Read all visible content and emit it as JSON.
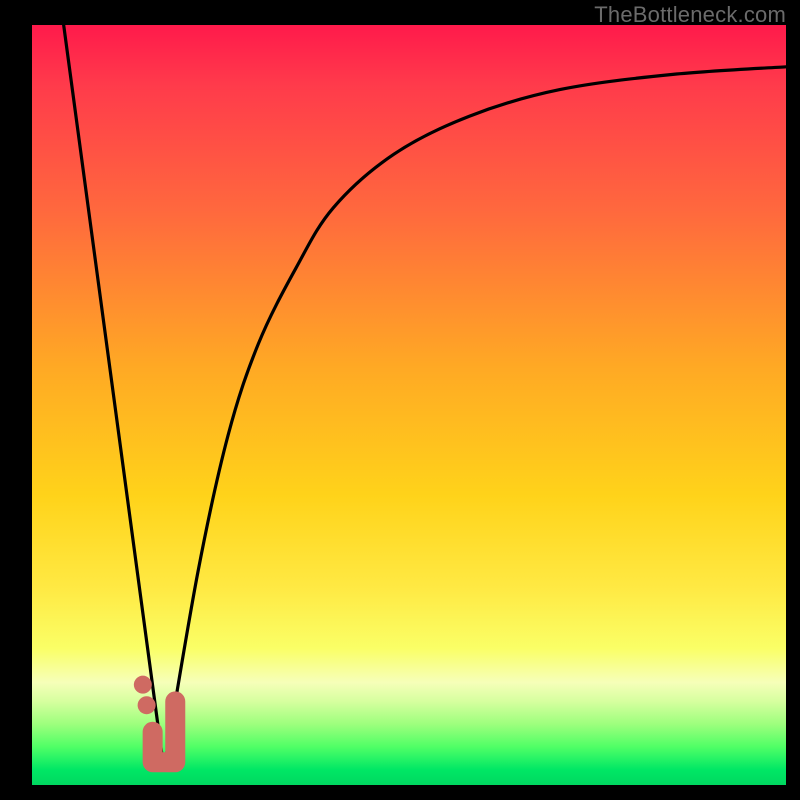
{
  "watermark": "TheBottleneck.com",
  "colors": {
    "frame": "#000000",
    "curve": "#000000",
    "marker": "#cf6a62",
    "gradient_top": "#ff1a4b",
    "gradient_bottom": "#00d760"
  },
  "chart_data": {
    "type": "line",
    "title": "",
    "xlabel": "",
    "ylabel": "",
    "xlim": [
      0,
      100
    ],
    "ylim": [
      0,
      100
    ],
    "series": [
      {
        "name": "left-descent",
        "x": [
          4.2,
          17.5
        ],
        "y": [
          100,
          2
        ]
      },
      {
        "name": "right-rise",
        "x": [
          17.5,
          22,
          26,
          30,
          35,
          40,
          48,
          58,
          70,
          85,
          100
        ],
        "y": [
          2,
          28,
          46,
          58,
          68,
          76,
          83,
          88,
          91.5,
          93.5,
          94.5
        ]
      }
    ],
    "markers": {
      "name": "j-marker",
      "segments": [
        {
          "from": [
            16.0,
            7.0
          ],
          "to": [
            16.0,
            3.0
          ]
        },
        {
          "from": [
            16.0,
            3.0
          ],
          "to": [
            19.0,
            3.0
          ]
        },
        {
          "from": [
            19.0,
            3.0
          ],
          "to": [
            19.0,
            11.0
          ]
        }
      ],
      "dots": [
        {
          "x": 15.2,
          "y": 10.5
        },
        {
          "x": 14.7,
          "y": 13.2
        }
      ]
    },
    "annotations": []
  }
}
